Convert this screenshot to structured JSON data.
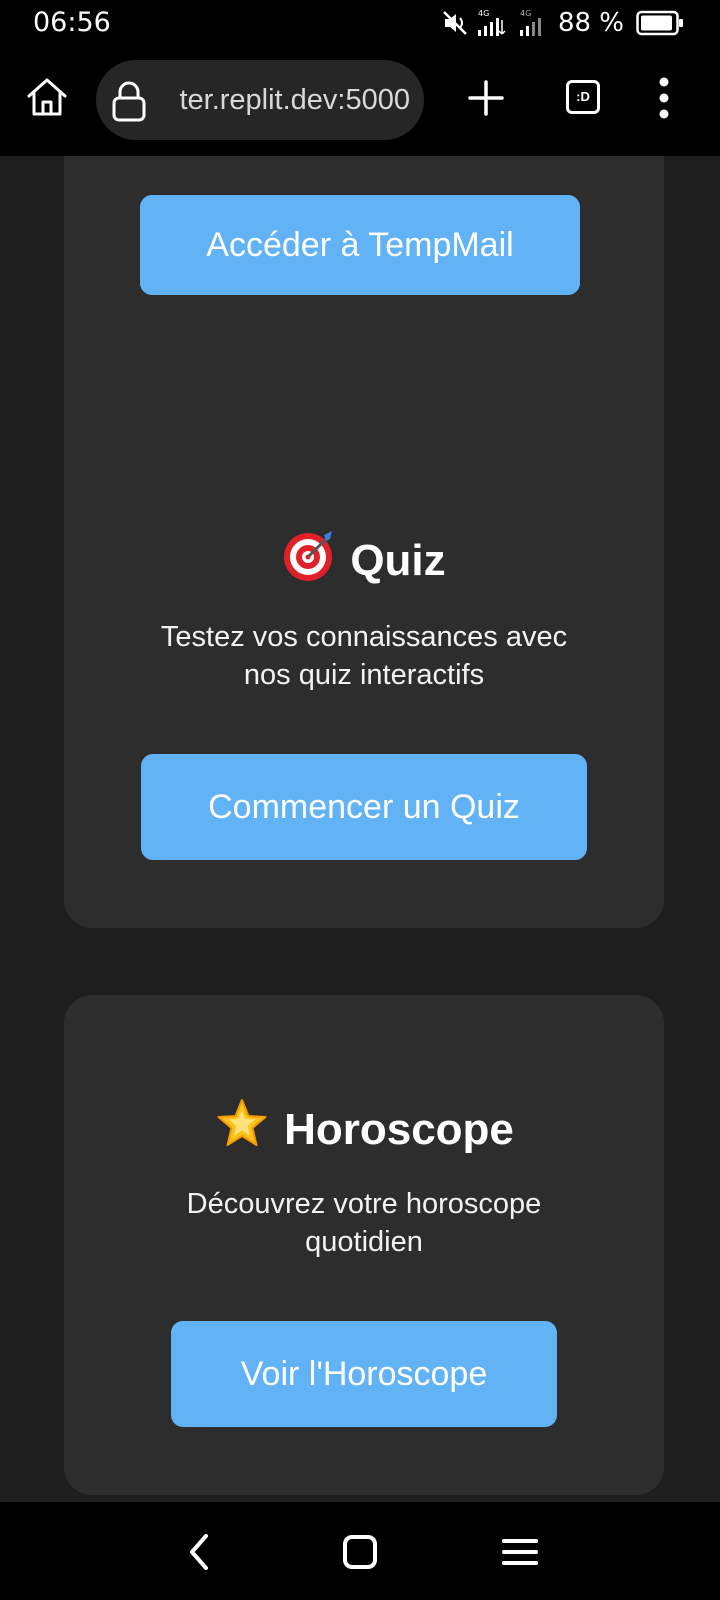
{
  "status_bar": {
    "time": "06:56",
    "battery": "88 %",
    "icons": [
      "mute-icon",
      "signal-4g-icon",
      "signal-4g-icon",
      "battery-icon"
    ]
  },
  "browser": {
    "url": "ter.replit.dev:5000",
    "tabs_count_label": ":D",
    "icons": [
      "home-icon",
      "lock-icon",
      "plus-icon",
      "tabs-icon",
      "more-vertical-icon"
    ]
  },
  "cards": {
    "tempmail": {
      "button": "Accéder à TempMail"
    },
    "quiz": {
      "icon": "dart-target-icon",
      "title": "Quiz",
      "desc_line1": "Testez vos connaissances avec",
      "desc_line2": "nos quiz interactifs",
      "button": "Commencer un Quiz"
    },
    "horoscope": {
      "icon": "glowing-star-icon",
      "title": "Horoscope",
      "desc_line1": "Découvrez votre horoscope",
      "desc_line2": "quotidien",
      "button": "Voir l'Horoscope"
    }
  },
  "nav": {
    "icons": [
      "back-icon",
      "home-square-icon",
      "recents-menu-icon"
    ]
  },
  "colors": {
    "page_bg": "#1e1e1e",
    "card_bg": "#2d2d2d",
    "button_bg": "#62b3f5",
    "bar_bg": "#000000"
  }
}
